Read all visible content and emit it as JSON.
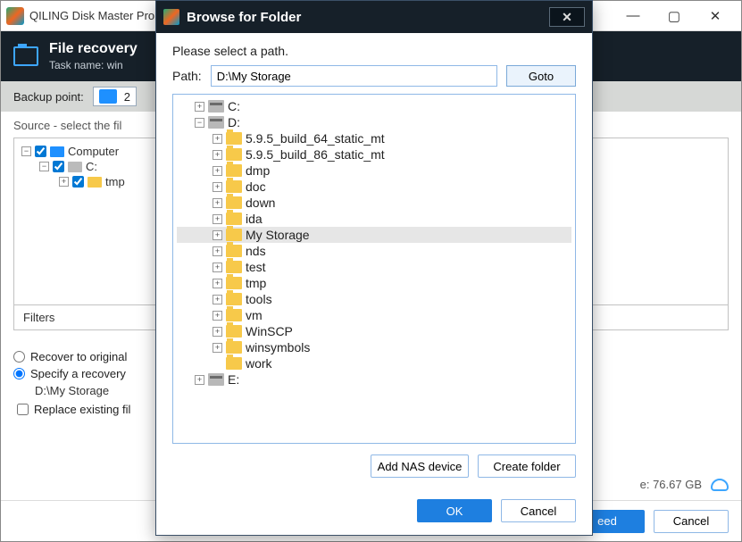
{
  "main": {
    "title": "QILING Disk Master Pro",
    "header_title": "File recovery",
    "header_sub_prefix": "Task name:",
    "header_sub_value": "win",
    "backup_label": "Backup point:",
    "backup_value": "2",
    "source_label": "Source - select the fil",
    "tree": {
      "root": "Computer",
      "drive": "C:",
      "folder": "tmp"
    },
    "filters": "Filters",
    "opts": {
      "recover_original": "Recover to original",
      "specify": "Specify a recovery",
      "path": "D:\\My Storage",
      "replace": "Replace existing fil"
    },
    "right_info": "e: 76.67 GB",
    "proceed": "eed",
    "cancel": "Cancel"
  },
  "dialog": {
    "title": "Browse for Folder",
    "prompt": "Please select a path.",
    "path_label": "Path:",
    "path_value": "D:\\My Storage",
    "goto": "Goto",
    "tree": {
      "c_label": "C:",
      "d_label": "D:",
      "e_label": "E:",
      "d_children": [
        "5.9.5_build_64_static_mt",
        "5.9.5_build_86_static_mt",
        "dmp",
        "doc",
        "down",
        "ida",
        "My Storage",
        "nds",
        "test",
        "tmp",
        "tools",
        "vm",
        "WinSCP",
        "winsymbols",
        "work"
      ],
      "selected": "My Storage"
    },
    "add_nas": "Add NAS device",
    "create_folder": "Create folder",
    "ok": "OK",
    "cancel": "Cancel"
  }
}
